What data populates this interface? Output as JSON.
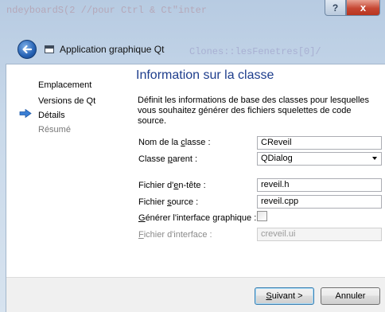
{
  "background": {
    "code_line_1": "ndeyboardS(2 //pour Ctrl & Ct\"inter",
    "code_line_2": "Clones::lesFenetres[0]/"
  },
  "window": {
    "app_title": "Application graphique Qt",
    "help_label": "?",
    "close_label": "x"
  },
  "steps": [
    {
      "label": "Emplacement"
    },
    {
      "label": "Versions de Qt"
    },
    {
      "label": "Détails"
    },
    {
      "label": "Résumé"
    }
  ],
  "page": {
    "title": "Information sur la classe",
    "description": "Définit les informations de base des classes pour lesquelles vous souhaitez générer des fichiers squelettes de code source."
  },
  "form": {
    "class_name": {
      "label_pre": "Nom de la ",
      "label_key": "c",
      "label_post": "lasse :",
      "value": "CReveil"
    },
    "parent_class": {
      "label_pre": "Classe ",
      "label_key": "p",
      "label_post": "arent :",
      "value": "QDialog"
    },
    "header_file": {
      "label_pre": "Fichier d'",
      "label_key": "e",
      "label_post": "n-tête :",
      "value": "reveil.h"
    },
    "source_file": {
      "label_pre": "Fichier ",
      "label_key": "s",
      "label_post": "ource :",
      "value": "reveil.cpp"
    },
    "generate_ui": {
      "label_key": "G",
      "label_post": "énérer l'interface graphique :",
      "checked": false
    },
    "ui_file": {
      "label_key": "F",
      "label_post": "ichier d'interface :",
      "value": "creveil.ui"
    }
  },
  "buttons": {
    "next_key": "S",
    "next_post": "uivant >",
    "cancel": "Annuler"
  },
  "colors": {
    "title_blue": "#1d3d8c",
    "step_arrow": "#3a7fd5"
  }
}
